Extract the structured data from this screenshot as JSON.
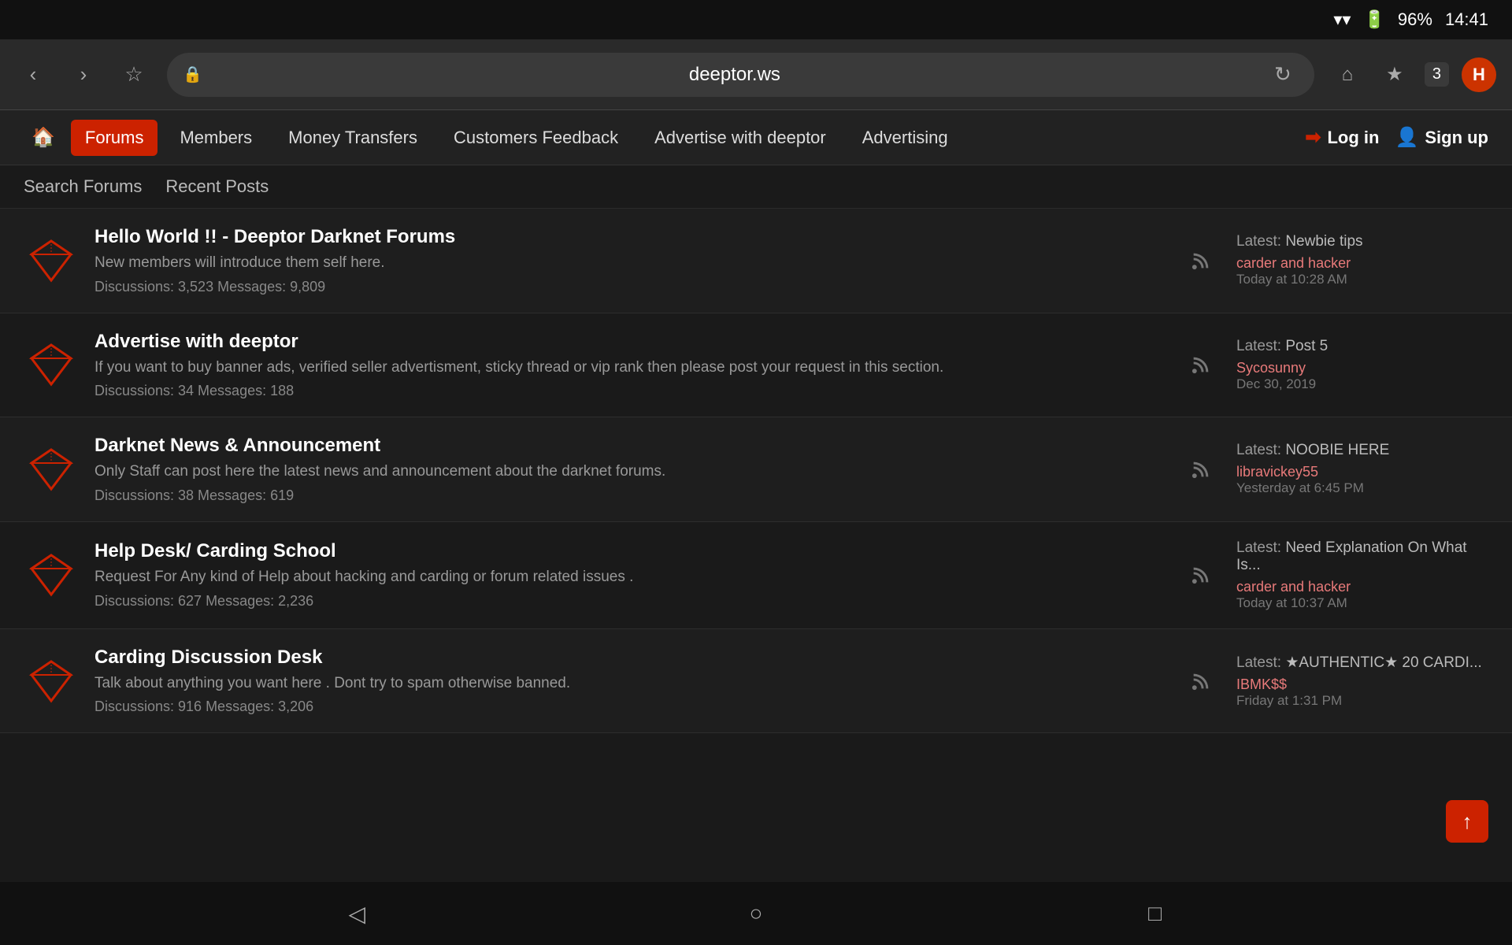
{
  "statusBar": {
    "battery": "96%",
    "time": "14:41"
  },
  "browser": {
    "url": "deeptor.ws",
    "tabsCount": "3",
    "menuAvatarLabel": "H",
    "backDisabled": false,
    "forwardDisabled": false
  },
  "siteNav": {
    "homeIcon": "🏠",
    "items": [
      {
        "label": "Forums",
        "active": true
      },
      {
        "label": "Members",
        "active": false
      },
      {
        "label": "Money Transfers",
        "active": false
      },
      {
        "label": "Customers Feedback",
        "active": false
      },
      {
        "label": "Advertise with deeptor",
        "active": false
      },
      {
        "label": "Advertising",
        "active": false
      }
    ],
    "loginLabel": "Log in",
    "signupLabel": "Sign up"
  },
  "subNav": {
    "items": [
      {
        "label": "Search Forums"
      },
      {
        "label": "Recent Posts"
      }
    ]
  },
  "forums": [
    {
      "title": "Hello World !! - Deeptor Darknet Forums",
      "desc": "New members will introduce them self here.",
      "discussions": "3,523",
      "messages": "9,809",
      "latestLabel": "Latest:",
      "latestTitle": "Newbie tips",
      "latestUser": "carder and hacker",
      "latestDate": "Today at 10:28 AM"
    },
    {
      "title": "Advertise with deeptor",
      "desc": "If you want to buy banner ads, verified seller advertisment, sticky thread or vip rank then please post your request in this section.",
      "discussions": "34",
      "messages": "188",
      "latestLabel": "Latest:",
      "latestTitle": "Post 5",
      "latestUser": "Sycosunny",
      "latestDate": "Dec 30, 2019"
    },
    {
      "title": "Darknet News & Announcement",
      "desc": "Only Staff can post here the latest news and announcement about the darknet forums.",
      "discussions": "38",
      "messages": "619",
      "latestLabel": "Latest:",
      "latestTitle": "NOOBIE HERE",
      "latestUser": "libravickey55",
      "latestDate": "Yesterday at 6:45 PM"
    },
    {
      "title": "Help Desk/ Carding School",
      "desc": "Request For Any kind of Help about hacking and carding or forum related issues .",
      "discussions": "627",
      "messages": "2,236",
      "latestLabel": "Latest:",
      "latestTitle": "Need Explanation On What Is...",
      "latestUser": "carder and hacker",
      "latestDate": "Today at 10:37 AM"
    },
    {
      "title": "Carding Discussion Desk",
      "desc": "Talk about anything you want here . Dont try to spam otherwise banned.",
      "discussions": "916",
      "messages": "3,206",
      "latestLabel": "Latest:",
      "latestTitle": "★AUTHENTIC★ 20 CARDI...",
      "latestUser": "IBMK$$",
      "latestDate": "Friday at 1:31 PM"
    }
  ],
  "scrollTop": "↑",
  "android": {
    "backIcon": "◁",
    "homeIcon": "○",
    "recentIcon": "□"
  }
}
